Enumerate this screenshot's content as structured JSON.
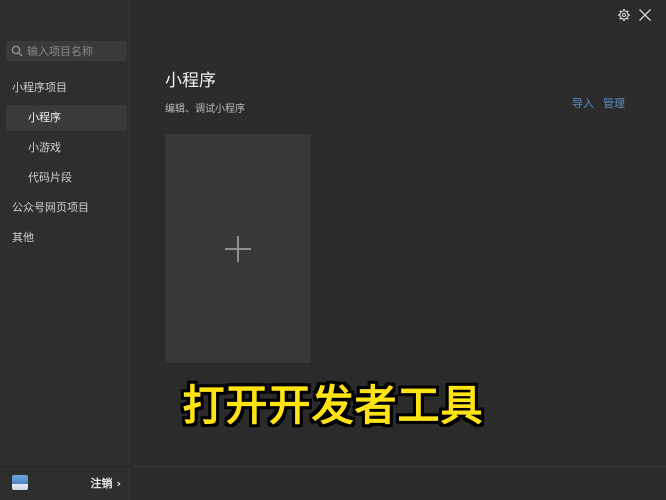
{
  "sidebar": {
    "search_placeholder": "输入项目名称",
    "groups": {
      "miniprogram_project": "小程序项目",
      "official_web": "公众号网页项目",
      "other": "其他"
    },
    "items": {
      "miniprogram": "小程序",
      "minigame": "小游戏",
      "code_snippet": "代码片段"
    },
    "footer": {
      "logout": "注销",
      "chevron": "›"
    }
  },
  "main": {
    "title": "小程序",
    "subtitle": "编辑、调试小程序",
    "actions": {
      "import": "导入",
      "manage": "管理"
    }
  },
  "overlay": {
    "caption": "打开开发者工具"
  },
  "colors": {
    "accent_link": "#5a8fc7",
    "caption_yellow": "#ffe313"
  },
  "icons": [
    "search-icon",
    "gear-icon",
    "close-icon",
    "plus-icon",
    "chevron-right-icon"
  ]
}
